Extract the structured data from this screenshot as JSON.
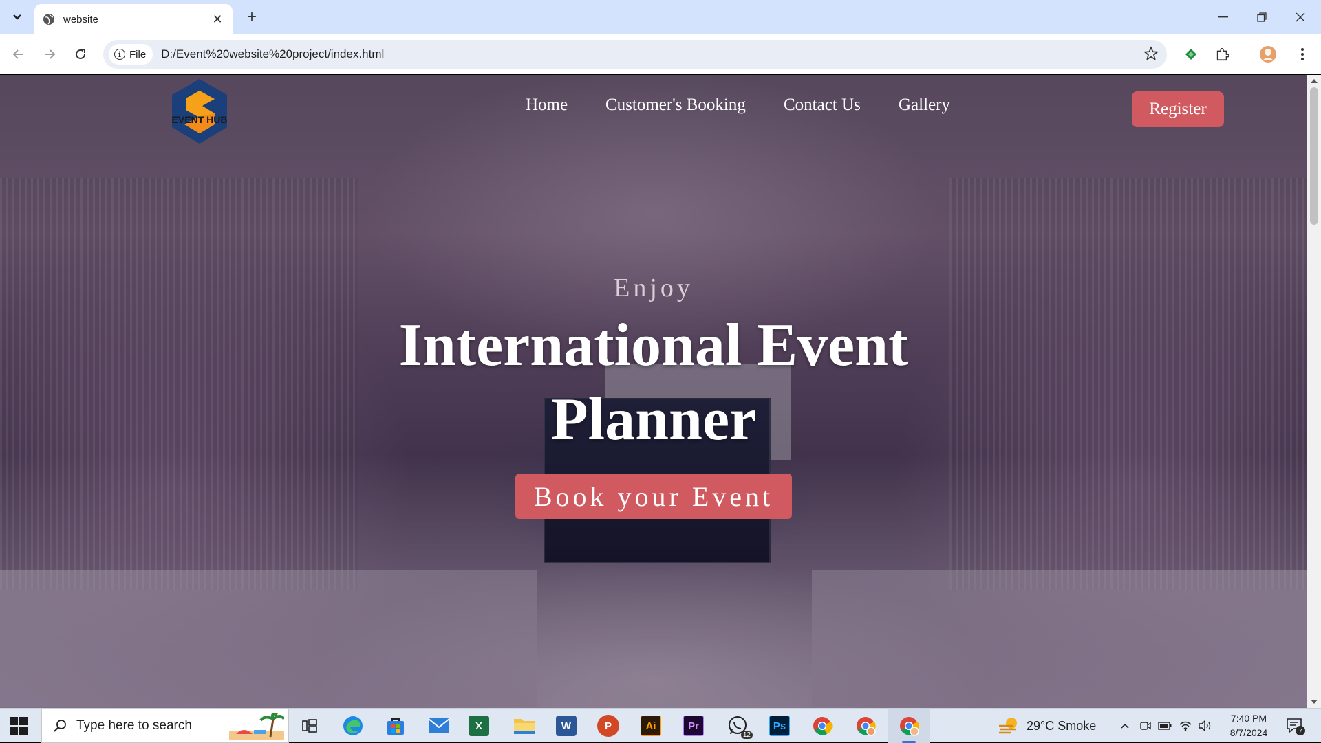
{
  "browser": {
    "tab_title": "website",
    "new_tab": "+",
    "close_tab": "✕",
    "security_chip": "File",
    "url": "D:/Event%20website%20project/index.html"
  },
  "site": {
    "logo_text": "EVENT HUB",
    "nav": [
      "Home",
      "Customer's Booking",
      "Contact Us",
      "Gallery"
    ],
    "register_label": "Register",
    "hero": {
      "kicker": "Enjoy",
      "headline_line1": "International Event",
      "headline_line2": "Planner",
      "cta_label": "Book your Event"
    }
  },
  "taskbar": {
    "search_placeholder": "Type here to search",
    "apps": [
      {
        "name": "task-view-icon",
        "label": ""
      },
      {
        "name": "edge-icon",
        "label": ""
      },
      {
        "name": "store-icon",
        "label": ""
      },
      {
        "name": "mail-icon",
        "label": ""
      },
      {
        "name": "excel-icon",
        "label": "X"
      },
      {
        "name": "file-explorer-icon",
        "label": ""
      },
      {
        "name": "word-icon",
        "label": "W"
      },
      {
        "name": "powerpoint-icon",
        "label": "P"
      },
      {
        "name": "illustrator-icon",
        "label": "Ai"
      },
      {
        "name": "premiere-icon",
        "label": "Pr"
      },
      {
        "name": "whatsapp-icon",
        "label": "",
        "badge": "12"
      },
      {
        "name": "photoshop-icon",
        "label": "Ps"
      },
      {
        "name": "chrome-icon",
        "label": ""
      },
      {
        "name": "chrome-profile-icon",
        "label": ""
      },
      {
        "name": "chrome-active-icon",
        "label": ""
      }
    ],
    "weather": "29°C  Smoke",
    "time": "7:40 PM",
    "date": "8/7/2024",
    "notification_count": "7"
  },
  "colors": {
    "accent": "#d05a5f",
    "tabbar": "#d3e3fd",
    "taskbar": "#dfe7f2"
  }
}
